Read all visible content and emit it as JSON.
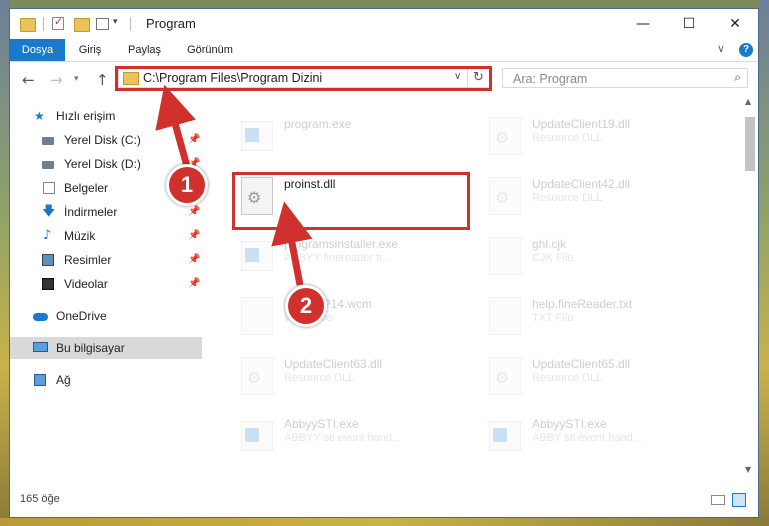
{
  "window": {
    "title": "Program",
    "controls": {
      "minimize": "—",
      "maximize": "☐",
      "close": "✕"
    }
  },
  "ribbon": {
    "tabs": [
      "Dosya",
      "Giriş",
      "Paylaş",
      "Görünüm"
    ],
    "help": "?"
  },
  "address": {
    "path": "C:\\Program Files\\Program Dizini"
  },
  "search": {
    "placeholder": "Ara: Program"
  },
  "navpane": {
    "items": [
      {
        "label": "Hızlı erişim",
        "icon": "star-icon",
        "pinned": false
      },
      {
        "label": "Yerel Disk (C:)",
        "icon": "disk-icon",
        "pinned": true
      },
      {
        "label": "Yerel Disk (D:)",
        "icon": "disk-icon",
        "pinned": true
      },
      {
        "label": "Belgeler",
        "icon": "documents-icon",
        "pinned": true
      },
      {
        "label": "İndirmeler",
        "icon": "download-icon",
        "pinned": true
      },
      {
        "label": "Müzik",
        "icon": "music-icon",
        "pinned": true
      },
      {
        "label": "Resimler",
        "icon": "pictures-icon",
        "pinned": true
      },
      {
        "label": "Videolar",
        "icon": "videos-icon",
        "pinned": true
      },
      {
        "label": "OneDrive",
        "icon": "cloud-icon",
        "pinned": false
      },
      {
        "label": "Bu bilgisayar",
        "icon": "computer-icon",
        "pinned": false
      },
      {
        "label": "Ağ",
        "icon": "network-icon",
        "pinned": false
      }
    ]
  },
  "files": {
    "left": [
      {
        "name": "program.exe",
        "type": "",
        "icon": "exe-icon"
      },
      {
        "name": "proinst.dll",
        "type": "",
        "icon": "dll-gear-icon"
      },
      {
        "name": "programsinstaller.exe",
        "type": "ABBYY finereader tr...",
        "icon": "exe-icon"
      },
      {
        "name": "ScanWP14.wcm",
        "type": "WCM File",
        "icon": "file-icon"
      },
      {
        "name": "UpdateClient63.dll",
        "type": "Resource DLL",
        "icon": "dll-gear-icon"
      },
      {
        "name": "AbbyySTI.exe",
        "type": "ABBYY sti event hand...",
        "icon": "exe-icon"
      }
    ],
    "right": [
      {
        "name": "UpdateClient19.dll",
        "type": "Resource DLL",
        "icon": "dll-gear-icon"
      },
      {
        "name": "UpdateClient42.dll",
        "type": "Resource DLL",
        "icon": "dll-gear-icon"
      },
      {
        "name": "ghl.cjk",
        "type": "CJK File",
        "icon": "file-icon"
      },
      {
        "name": "help.fineReader.txt",
        "type": "TXT File",
        "icon": "file-icon"
      },
      {
        "name": "UpdateClient65.dll",
        "type": "Resource DLL",
        "icon": "dll-gear-icon"
      },
      {
        "name": "AbbyySTI.exe",
        "type": "ABBY sti event hand...",
        "icon": "exe-icon"
      }
    ]
  },
  "statusbar": {
    "count": "165 öğe"
  },
  "callouts": [
    "1",
    "2"
  ],
  "colors": {
    "accent": "#1979ca",
    "highlight": "#d0312d"
  }
}
